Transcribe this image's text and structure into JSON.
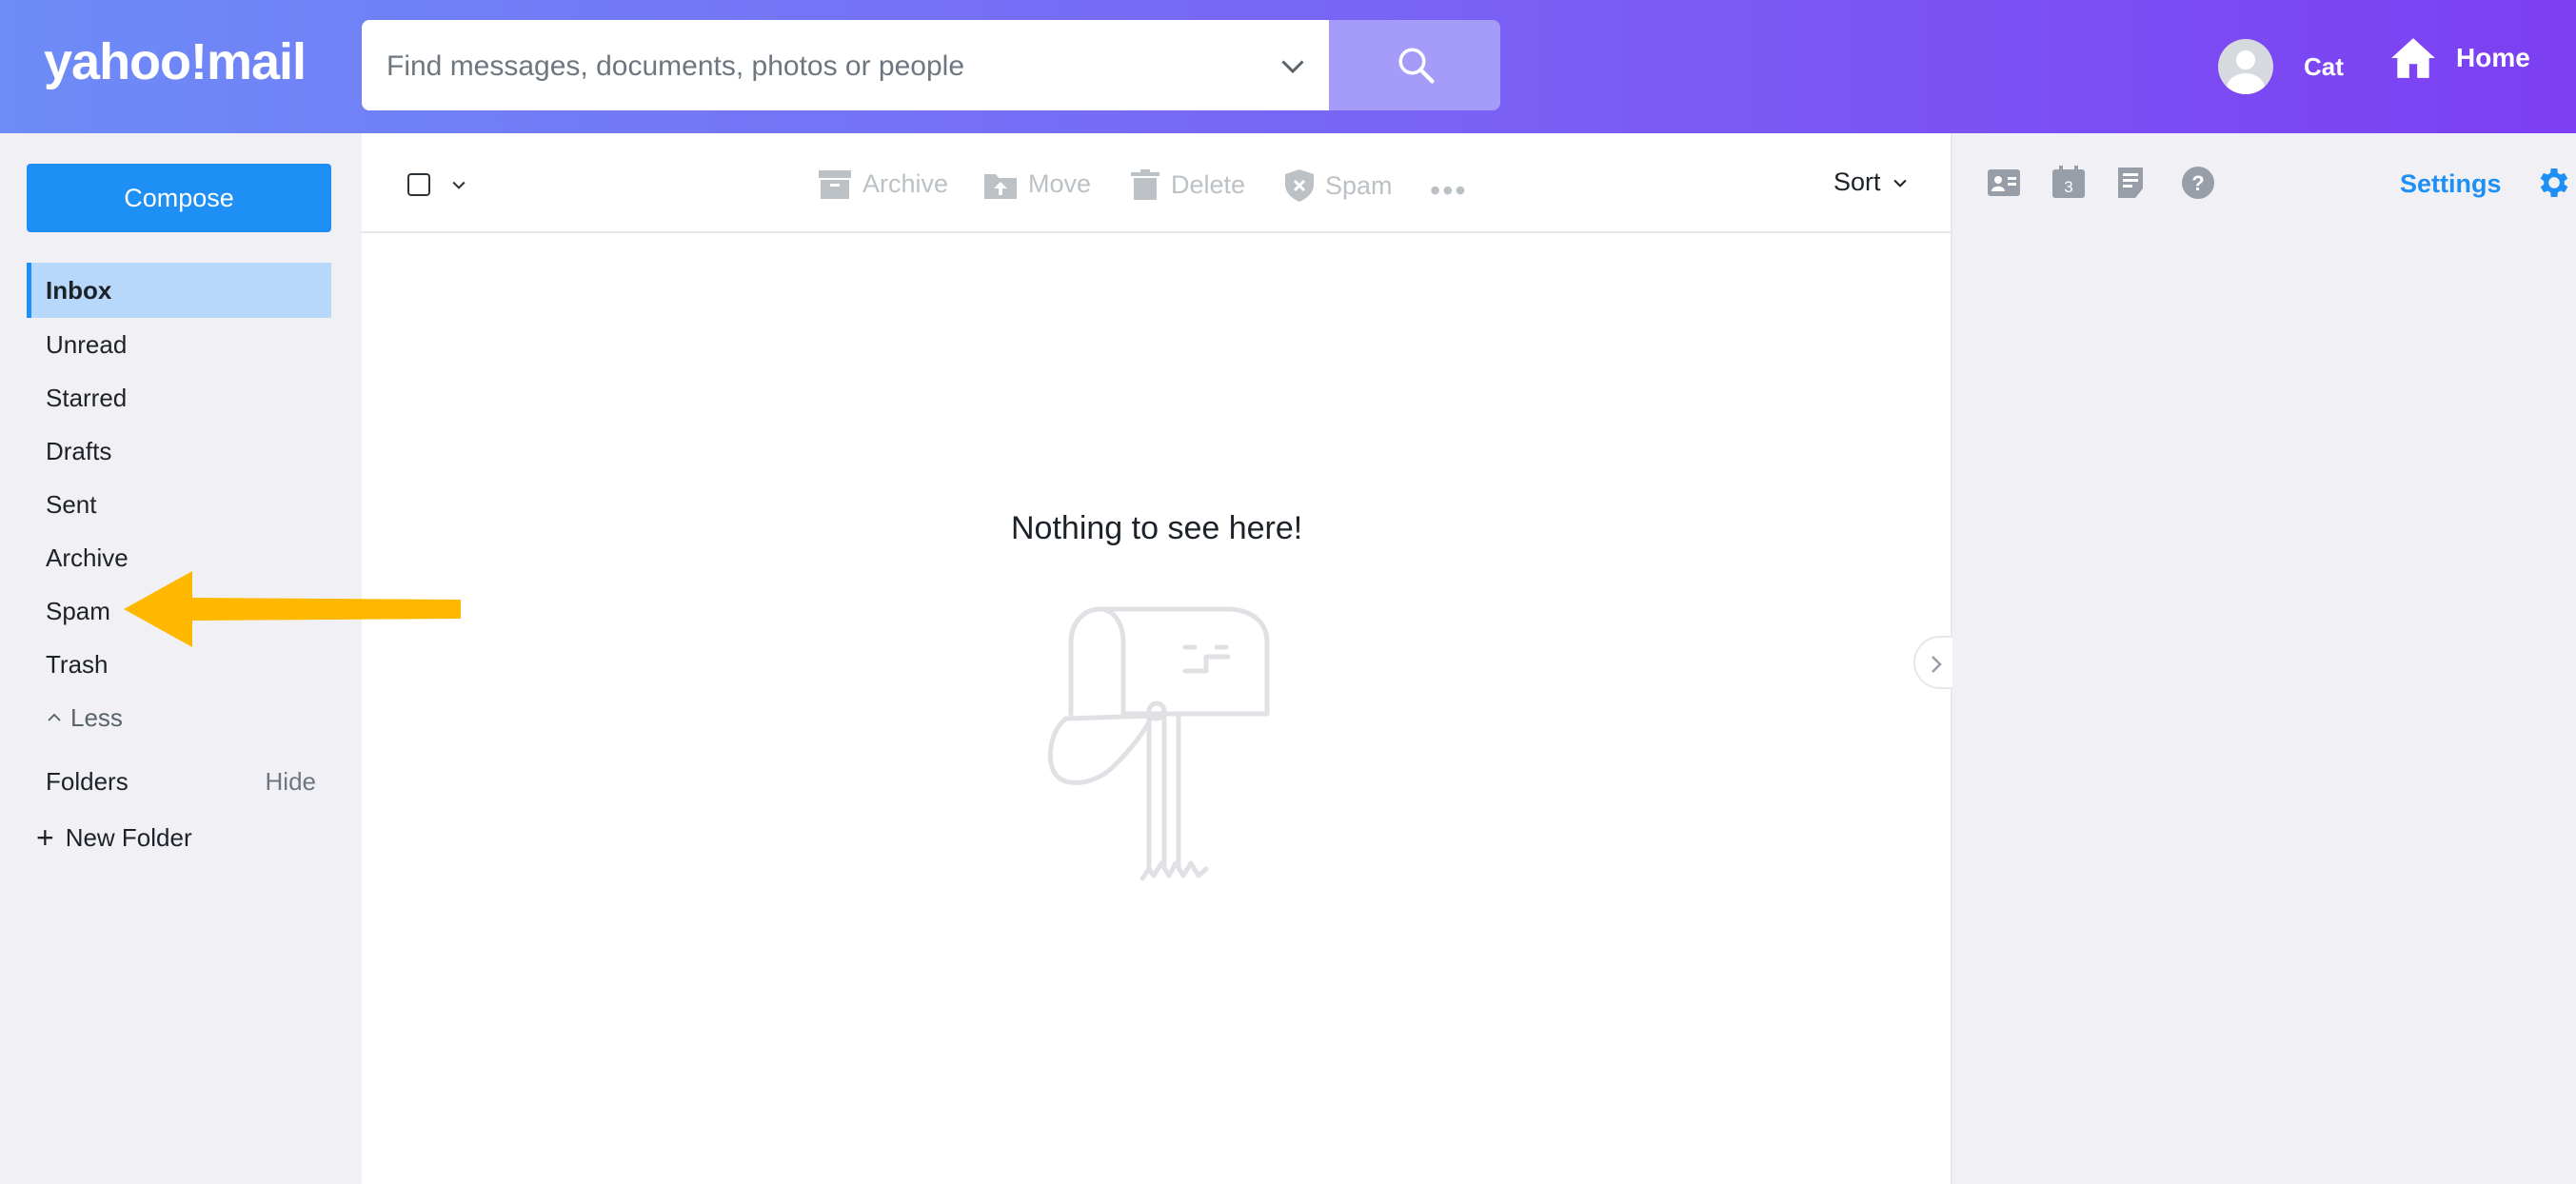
{
  "app": {
    "logo_text": "yahoo!mail"
  },
  "search": {
    "placeholder": "Find messages, documents, photos or people"
  },
  "user": {
    "name": "Cat"
  },
  "home": {
    "label": "Home"
  },
  "sidebar": {
    "compose_label": "Compose",
    "items": [
      {
        "label": "Inbox",
        "active": true
      },
      {
        "label": "Unread"
      },
      {
        "label": "Starred"
      },
      {
        "label": "Drafts"
      },
      {
        "label": "Sent"
      },
      {
        "label": "Archive"
      },
      {
        "label": "Spam"
      },
      {
        "label": "Trash"
      }
    ],
    "less_label": "Less",
    "folders_label": "Folders",
    "hide_label": "Hide",
    "new_folder_label": "New Folder"
  },
  "toolbar": {
    "archive_label": "Archive",
    "move_label": "Move",
    "delete_label": "Delete",
    "spam_label": "Spam",
    "sort_label": "Sort"
  },
  "main": {
    "empty_message": "Nothing to see here!"
  },
  "right_panel": {
    "calendar_day": "3",
    "settings_label": "Settings",
    "icons": [
      "contacts-icon",
      "calendar-icon",
      "notepad-icon",
      "help-icon"
    ]
  },
  "colors": {
    "accent": "#1d8ff5",
    "active_item_bg": "#b8d8fb",
    "annotation_arrow": "#ffb800",
    "header_gradient_start": "#6d8cf7",
    "header_gradient_end": "#7c3ff2"
  }
}
